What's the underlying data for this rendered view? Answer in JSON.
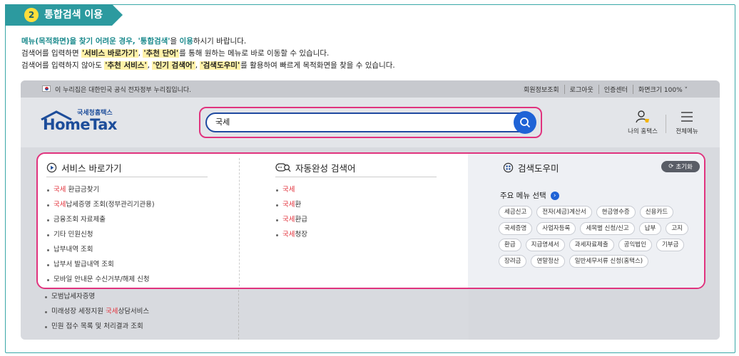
{
  "step": {
    "number": "2",
    "title": "통합검색 이용"
  },
  "description": {
    "line1_a": "메뉴(목적화면)을 찾기 어려운 경우, ",
    "line1_b": "'통합검색'",
    "line1_c": "을 ",
    "line1_d": "이용",
    "line1_e": "하시기 바랍니다.",
    "line2_a": "검색어를 입력하면 ",
    "line2_b": "'서비스 바로가기'",
    "line2_c": ", ",
    "line2_d": "'추천 단어'",
    "line2_e": "를 통해 원하는 메뉴로 바로 이동할 수 있습니다.",
    "line3_a": "검색어를 입력하지 않아도 ",
    "line3_b": "'추천 서비스'",
    "line3_c": ", ",
    "line3_d": "'인기 검색어'",
    "line3_e": ", ",
    "line3_f": "'검색도우미'",
    "line3_g": "를 활용하여 빠르게 목적화면을 찾을 수 있습니다."
  },
  "topbar": {
    "notice": "이 누리집은 대한민국 공식 전자정부 누리집입니다.",
    "links": [
      "회원정보조회",
      "로그아웃",
      "인증센터",
      "화면크기 100% ˅"
    ]
  },
  "header": {
    "logo_sub": "국세청홈택스",
    "logo_main": "HomeTax",
    "search_value": "국세",
    "my_hometax": "나의 홈택스",
    "all_menu": "전체메뉴"
  },
  "service_shortcut": {
    "title": "서비스 바로가기",
    "items": [
      {
        "red": "국세",
        "rest": " 환급금찾기"
      },
      {
        "red": "국세",
        "rest": "납세증명 조회(정부관리기관용)"
      },
      {
        "red": "",
        "rest": "금융조회 자료제출"
      },
      {
        "red": "",
        "rest": "기타 민원신청"
      },
      {
        "red": "",
        "rest": "납부내역 조회"
      },
      {
        "red": "",
        "rest": "납부서 발급내역 조회"
      },
      {
        "red": "",
        "rest": "모바일 안내문 수신거부/해제 신청"
      }
    ],
    "more_items": [
      {
        "red": "",
        "rest": "모범납세자증명"
      },
      {
        "pre": "미래성장 세정지원 ",
        "red": "국세",
        "rest": "상담서비스"
      },
      {
        "red": "",
        "rest": "민원 접수 목록 및 처리결과 조회"
      }
    ]
  },
  "autocomplete": {
    "title": "자동완성 검색어",
    "items": [
      {
        "red": "국세",
        "rest": ""
      },
      {
        "red": "국세",
        "rest": "환"
      },
      {
        "red": "국세",
        "rest": "환급"
      },
      {
        "red": "국세",
        "rest": "청장"
      }
    ]
  },
  "search_helper": {
    "title": "검색도우미",
    "reset": "초기화",
    "main_menu_label": "주요 메뉴 선택",
    "tags": [
      "세금신고",
      "전자(세금)계산서",
      "현금영수증",
      "신용카드",
      "국세증명",
      "사업자등록",
      "세목별 신청/신고",
      "납부",
      "고지",
      "환급",
      "지급명세서",
      "과세자료제출",
      "공익법인",
      "기부금",
      "장려금",
      "연말정산",
      "일반세무서류 신청(홈택스)"
    ]
  },
  "colors": {
    "accent_teal": "#2c9a9f",
    "highlight_pink": "#e0337e",
    "search_blue": "#1f63d6",
    "keyword_red": "#e2343d"
  }
}
